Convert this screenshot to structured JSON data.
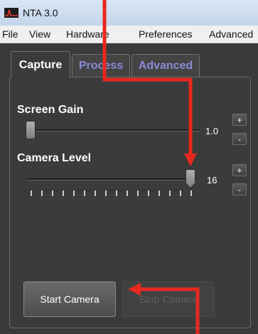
{
  "window": {
    "title": "NTA 3.0"
  },
  "menu": [
    "File",
    "View",
    "Hardware",
    "Preferences",
    "Advanced"
  ],
  "tabs": [
    "Capture",
    "Process",
    "Advanced"
  ],
  "screen_gain": {
    "label": "Screen Gain",
    "value": "1.0",
    "plus": "+",
    "minus": "-"
  },
  "camera_level": {
    "label": "Camera Level",
    "value": "16",
    "plus": "+",
    "minus": "-"
  },
  "buttons": {
    "start": "Start Camera",
    "stop": "Stop Camera"
  },
  "annotation_color": "#e8281e",
  "icons": {
    "app": "nta-waveform-icon"
  }
}
